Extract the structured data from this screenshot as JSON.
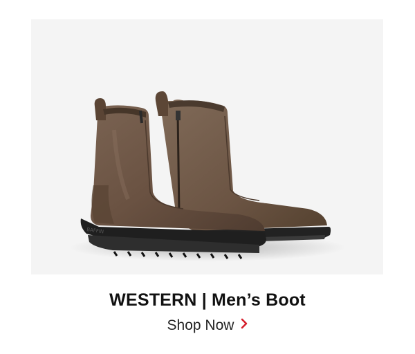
{
  "product": {
    "title": "WESTERN | Men’s Boot",
    "image_icon": "boot-pair-image"
  },
  "cta": {
    "label": "Shop Now",
    "icon": "chevron-right-icon"
  },
  "colors": {
    "accent": "#d6202d",
    "panel_bg": "#f4f4f4",
    "title": "#111111",
    "boot_leather": "#6b5443",
    "sole": "#2a2a2a"
  }
}
